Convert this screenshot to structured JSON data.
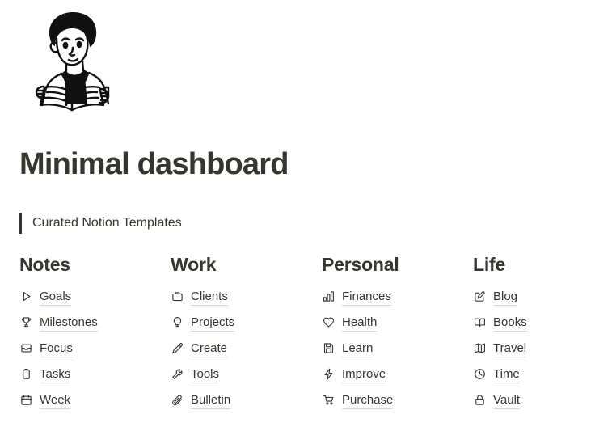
{
  "page": {
    "background_color": "#ffffff",
    "text_color": "#37352f",
    "underline_color": "#d7d4cf"
  },
  "avatar": {
    "icon": "person-reading-book-illustration",
    "alt": "Line art illustration of a person reading an open book"
  },
  "header": {
    "title": "Minimal dashboard"
  },
  "quote": {
    "text": "Curated Notion Templates"
  },
  "columns": [
    {
      "heading": "Notes",
      "links": [
        {
          "label": "Goals",
          "icon": "play-triangle-icon"
        },
        {
          "label": "Milestones",
          "icon": "trophy-icon"
        },
        {
          "label": "Focus",
          "icon": "inbox-tray-icon"
        },
        {
          "label": "Tasks",
          "icon": "clipboard-icon"
        },
        {
          "label": "Week",
          "icon": "calendar-icon"
        }
      ]
    },
    {
      "heading": "Work",
      "links": [
        {
          "label": "Clients",
          "icon": "briefcase-icon"
        },
        {
          "label": "Projects",
          "icon": "lightbulb-icon"
        },
        {
          "label": "Create",
          "icon": "pencil-icon"
        },
        {
          "label": "Tools",
          "icon": "wrench-icon"
        },
        {
          "label": "Bulletin",
          "icon": "paperclip-icon"
        }
      ]
    },
    {
      "heading": "Personal",
      "links": [
        {
          "label": "Finances",
          "icon": "bar-chart-icon"
        },
        {
          "label": "Health",
          "icon": "heart-icon"
        },
        {
          "label": "Learn",
          "icon": "floppy-disk-icon"
        },
        {
          "label": "Improve",
          "icon": "lightning-bolt-icon"
        },
        {
          "label": "Purchase",
          "icon": "shopping-cart-icon"
        }
      ]
    },
    {
      "heading": "Life",
      "links": [
        {
          "label": "Blog",
          "icon": "edit-square-icon"
        },
        {
          "label": "Books",
          "icon": "open-book-icon"
        },
        {
          "label": "Travel",
          "icon": "folded-map-icon"
        },
        {
          "label": "Time",
          "icon": "clock-icon"
        },
        {
          "label": "Vault",
          "icon": "lock-icon"
        }
      ]
    }
  ]
}
